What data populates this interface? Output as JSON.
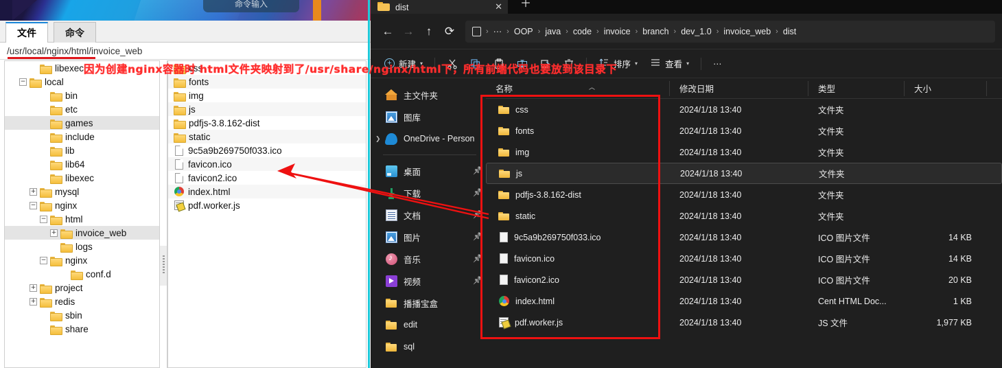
{
  "sftp": {
    "wallpaper_tooltip": "命令输入",
    "tabs": [
      {
        "label": "文件",
        "active": true
      },
      {
        "label": "命令",
        "active": false
      }
    ],
    "path": "/usr/local/nginx/html/invoice_web",
    "tree": [
      {
        "label": "libexec",
        "indent": 2,
        "expander": "",
        "icon": "folder-icon",
        "selected": false
      },
      {
        "label": "local",
        "indent": 1,
        "expander": "−",
        "icon": "folder-icon",
        "selected": false
      },
      {
        "label": "bin",
        "indent": 3,
        "expander": "",
        "icon": "folder-icon",
        "selected": false
      },
      {
        "label": "etc",
        "indent": 3,
        "expander": "",
        "icon": "folder-icon",
        "selected": false
      },
      {
        "label": "games",
        "indent": 3,
        "expander": "",
        "icon": "folder-icon",
        "selected": true
      },
      {
        "label": "include",
        "indent": 3,
        "expander": "",
        "icon": "folder-icon",
        "selected": false
      },
      {
        "label": "lib",
        "indent": 3,
        "expander": "",
        "icon": "folder-icon",
        "selected": false
      },
      {
        "label": "lib64",
        "indent": 3,
        "expander": "",
        "icon": "folder-icon",
        "selected": false
      },
      {
        "label": "libexec",
        "indent": 3,
        "expander": "",
        "icon": "folder-icon",
        "selected": false
      },
      {
        "label": "mysql",
        "indent": 2,
        "expander": "+",
        "icon": "folder-icon",
        "selected": false
      },
      {
        "label": "nginx",
        "indent": 2,
        "expander": "−",
        "icon": "folder-icon",
        "selected": false
      },
      {
        "label": "html",
        "indent": 3,
        "expander": "−",
        "icon": "folder-icon",
        "selected": false
      },
      {
        "label": "invoice_web",
        "indent": 4,
        "expander": "+",
        "icon": "folder-icon",
        "selected": true
      },
      {
        "label": "logs",
        "indent": 4,
        "expander": "",
        "icon": "folder-icon",
        "selected": false
      },
      {
        "label": "nginx",
        "indent": 3,
        "expander": "−",
        "icon": "folder-icon",
        "selected": false
      },
      {
        "label": "conf.d",
        "indent": 5,
        "expander": "",
        "icon": "folder-icon",
        "selected": false
      },
      {
        "label": "project",
        "indent": 2,
        "expander": "+",
        "icon": "folder-icon",
        "selected": false
      },
      {
        "label": "redis",
        "indent": 2,
        "expander": "+",
        "icon": "folder-icon",
        "selected": false
      },
      {
        "label": "sbin",
        "indent": 3,
        "expander": "",
        "icon": "folder-icon",
        "selected": false
      },
      {
        "label": "share",
        "indent": 3,
        "expander": "",
        "icon": "folder-icon",
        "selected": false
      }
    ],
    "files": [
      {
        "name": "css",
        "icon": "folder-icon"
      },
      {
        "name": "fonts",
        "icon": "folder-icon"
      },
      {
        "name": "img",
        "icon": "folder-icon"
      },
      {
        "name": "js",
        "icon": "folder-icon"
      },
      {
        "name": "pdfjs-3.8.162-dist",
        "icon": "folder-icon"
      },
      {
        "name": "static",
        "icon": "folder-icon"
      },
      {
        "name": "9c5a9b269750f033.ico",
        "icon": "file-icon"
      },
      {
        "name": "favicon.ico",
        "icon": "file-icon"
      },
      {
        "name": "favicon2.ico",
        "icon": "file-icon"
      },
      {
        "name": "index.html",
        "icon": "chrome-html-icon"
      },
      {
        "name": "pdf.worker.js",
        "icon": "js-file-icon"
      }
    ]
  },
  "explorer": {
    "tab": {
      "title": "dist",
      "close_label": "✕"
    },
    "new_tab_label": "＋",
    "nav": {
      "back": "←",
      "forward": "→",
      "up": "↑",
      "refresh": "⟳"
    },
    "breadcrumb": {
      "overflow": "···",
      "items": [
        "OOP",
        "java",
        "code",
        "invoice",
        "branch",
        "dev_1.0",
        "invoice_web",
        "dist"
      ],
      "separator": "›"
    },
    "toolbar": {
      "new_label": "新建",
      "sort_label": "排序",
      "view_label": "查看",
      "more_label": "···",
      "icons": [
        "cut-icon",
        "copy-icon",
        "paste-icon",
        "rename-icon",
        "share-icon",
        "delete-icon"
      ]
    },
    "sidebar": [
      {
        "label": "主文件夹",
        "icon": "home-icon",
        "pinned": false,
        "chevron": false
      },
      {
        "label": "图库",
        "icon": "gallery-icon",
        "pinned": false,
        "chevron": false
      },
      {
        "label": "OneDrive - Person",
        "icon": "onedrive-icon",
        "pinned": false,
        "chevron": true
      },
      {
        "label": "桌面",
        "icon": "desktop-icon",
        "pinned": true,
        "chevron": false
      },
      {
        "label": "下载",
        "icon": "downloads-icon",
        "pinned": true,
        "chevron": false
      },
      {
        "label": "文档",
        "icon": "documents-icon",
        "pinned": true,
        "chevron": false
      },
      {
        "label": "图片",
        "icon": "pictures-icon",
        "pinned": true,
        "chevron": false
      },
      {
        "label": "音乐",
        "icon": "music-icon",
        "pinned": true,
        "chevron": false
      },
      {
        "label": "视频",
        "icon": "videos-icon",
        "pinned": true,
        "chevron": false
      },
      {
        "label": "播播宝盒",
        "icon": "folder-icon",
        "pinned": false,
        "chevron": false
      },
      {
        "label": "edit",
        "icon": "folder-icon",
        "pinned": false,
        "chevron": false
      },
      {
        "label": "sql",
        "icon": "folder-icon",
        "pinned": false,
        "chevron": false
      }
    ],
    "columns": [
      "名称",
      "修改日期",
      "类型",
      "大小"
    ],
    "rows": [
      {
        "name": "css",
        "date": "2024/1/18 13:40",
        "type": "文件夹",
        "size": "",
        "icon": "folder-icon",
        "selected": false
      },
      {
        "name": "fonts",
        "date": "2024/1/18 13:40",
        "type": "文件夹",
        "size": "",
        "icon": "folder-icon",
        "selected": false
      },
      {
        "name": "img",
        "date": "2024/1/18 13:40",
        "type": "文件夹",
        "size": "",
        "icon": "folder-icon",
        "selected": false
      },
      {
        "name": "js",
        "date": "2024/1/18 13:40",
        "type": "文件夹",
        "size": "",
        "icon": "folder-icon",
        "selected": true
      },
      {
        "name": "pdfjs-3.8.162-dist",
        "date": "2024/1/18 13:40",
        "type": "文件夹",
        "size": "",
        "icon": "folder-icon",
        "selected": false
      },
      {
        "name": "static",
        "date": "2024/1/18 13:40",
        "type": "文件夹",
        "size": "",
        "icon": "folder-icon",
        "selected": false
      },
      {
        "name": "9c5a9b269750f033.ico",
        "date": "2024/1/18 13:40",
        "type": "ICO 图片文件",
        "size": "14 KB",
        "icon": "file-icon",
        "selected": false
      },
      {
        "name": "favicon.ico",
        "date": "2024/1/18 13:40",
        "type": "ICO 图片文件",
        "size": "14 KB",
        "icon": "file-icon",
        "selected": false
      },
      {
        "name": "favicon2.ico",
        "date": "2024/1/18 13:40",
        "type": "ICO 图片文件",
        "size": "20 KB",
        "icon": "file-icon",
        "selected": false
      },
      {
        "name": "index.html",
        "date": "2024/1/18 13:40",
        "type": "Cent HTML Doc...",
        "size": "1 KB",
        "icon": "chrome-html-icon",
        "selected": false
      },
      {
        "name": "pdf.worker.js",
        "date": "2024/1/18 13:40",
        "type": "JS 文件",
        "size": "1,977 KB",
        "icon": "js-file-icon",
        "selected": false
      }
    ]
  },
  "annotations": {
    "note": "因为创建nginx容器时 html文件夹映射到了/usr/share/nginx/html下，所有前端代码也要放到该目录下",
    "color": "#ff2d2d",
    "box_color": "#ee1111"
  }
}
